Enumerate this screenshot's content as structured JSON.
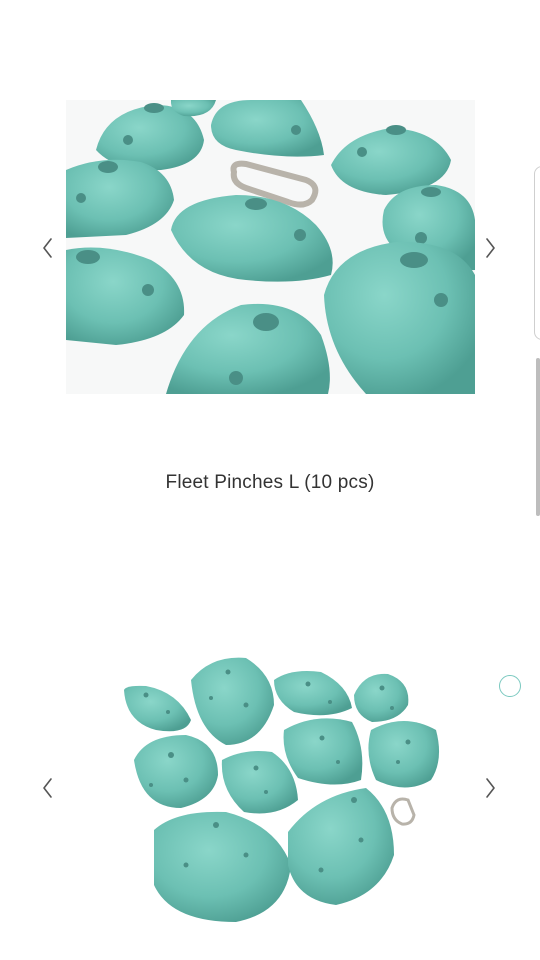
{
  "products": [
    {
      "image_alt": "",
      "title": ""
    },
    {
      "image_alt": "",
      "title": "Fleet Pinches L (10 pcs)"
    }
  ],
  "carousel": {
    "prev_icon": "chevron-left-icon",
    "next_icon": "chevron-right-icon"
  },
  "colors": {
    "hold_teal": "#6cc0b3",
    "hold_shadow": "#4e9f93",
    "title_text": "#333333",
    "indicator": "#7bc9c0"
  }
}
